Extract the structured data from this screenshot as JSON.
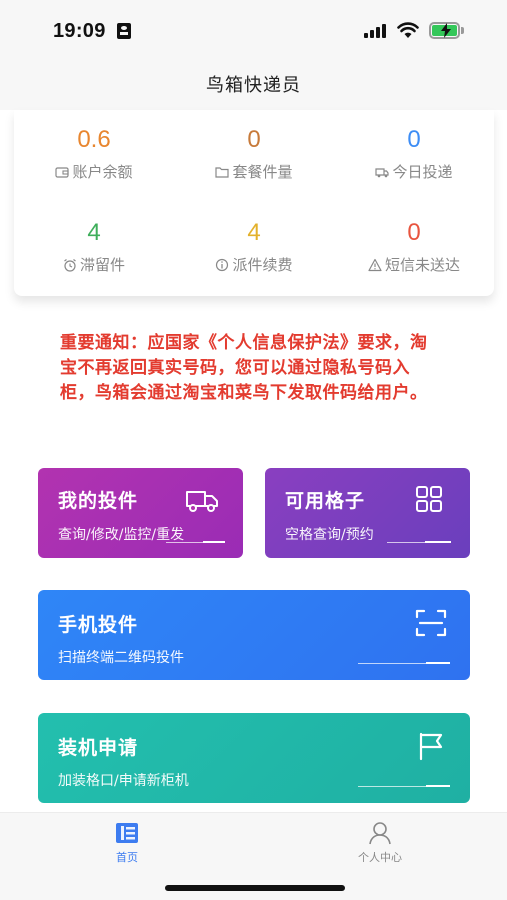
{
  "status_bar": {
    "time": "19:09"
  },
  "nav": {
    "title": "鸟箱快递员"
  },
  "stats": [
    {
      "value": "0.6",
      "label": "账户余额",
      "icon": "wallet-icon",
      "color": "#e8862f"
    },
    {
      "value": "0",
      "label": "套餐件量",
      "icon": "folder-icon",
      "color": "#c77a3a"
    },
    {
      "value": "0",
      "label": "今日投递",
      "icon": "truck-icon",
      "color": "#3d8df5"
    },
    {
      "value": "4",
      "label": "滞留件",
      "icon": "alarm-clock-icon",
      "color": "#3fae5b"
    },
    {
      "value": "4",
      "label": "派件续费",
      "icon": "info-icon",
      "color": "#e3b12c"
    },
    {
      "value": "0",
      "label": "短信未送达",
      "icon": "warning-icon",
      "color": "#e8553f"
    }
  ],
  "notice": {
    "text": "重要通知：应国家《个人信息保护法》要求，淘宝不再返回真实号码，您可以通过隐私号码入柜，鸟箱会通过淘宝和菜鸟下发取件码给用户。"
  },
  "tiles": {
    "my_deliveries": {
      "title": "我的投件",
      "subtitle": "查询/修改/监控/重发",
      "icon": "truck-icon",
      "color": "#a82fb0"
    },
    "available_cells": {
      "title": "可用格子",
      "subtitle": "空格查询/预约",
      "icon": "grid-icon",
      "color": "#7840c0"
    },
    "phone_delivery": {
      "title": "手机投件",
      "subtitle": "扫描终端二维码投件",
      "icon": "scan-icon",
      "color": "#2f7ff6"
    },
    "install_request": {
      "title": "装机申请",
      "subtitle": "加装格口/申请新柜机",
      "icon": "flag-icon",
      "color": "#22b8a8"
    }
  },
  "tabs": [
    {
      "label": "首页",
      "icon": "home-icon",
      "active": true,
      "color": "#3d7cf0"
    },
    {
      "label": "个人中心",
      "icon": "user-icon",
      "active": false,
      "color": "#888888"
    }
  ]
}
